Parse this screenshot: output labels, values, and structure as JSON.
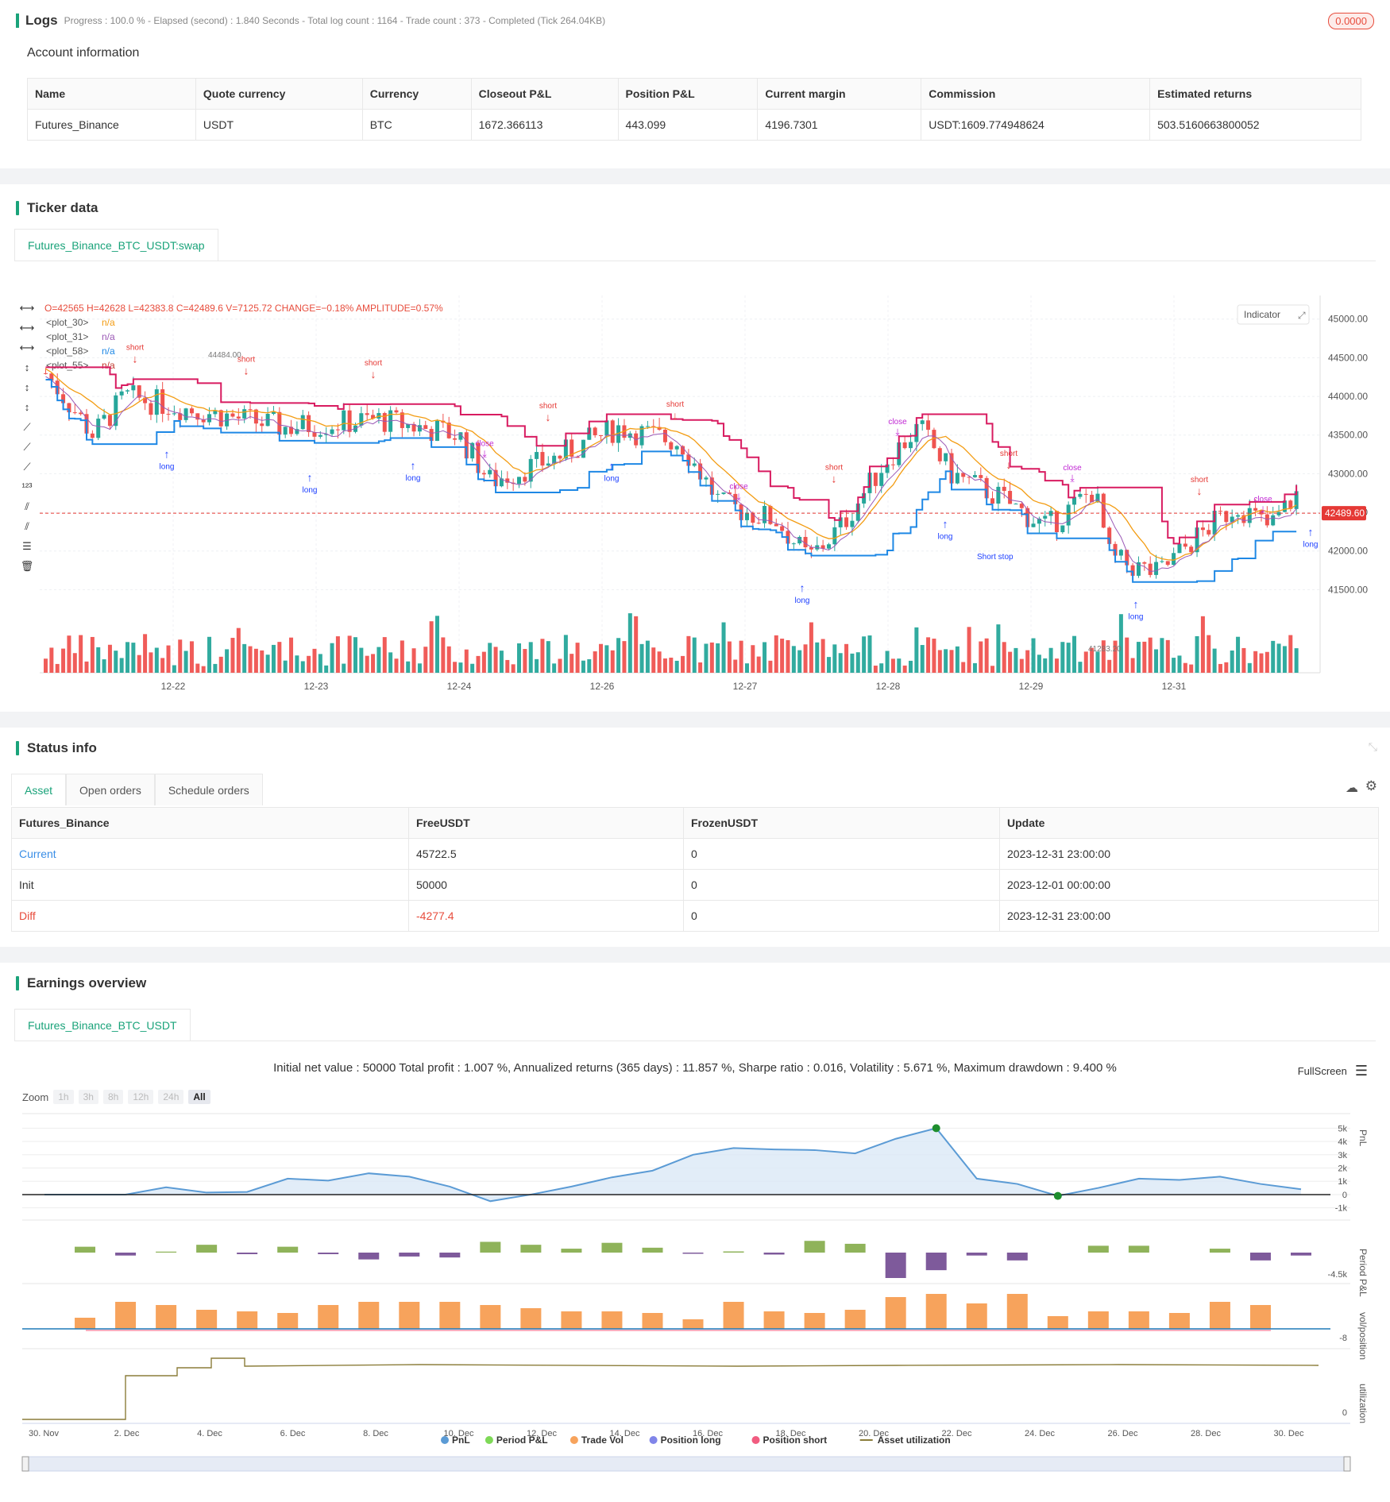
{
  "logs": {
    "title": "Logs",
    "meta": "Progress : 100.0 % - Elapsed (second) : 1.840  Seconds - Total log count : 1164 - Trade count : 373 - Completed (Tick 264.04KB)",
    "badge": "0.0000"
  },
  "account": {
    "title": "Account information",
    "headers": [
      "Name",
      "Quote currency",
      "Currency",
      "Closeout P&L",
      "Position P&L",
      "Current margin",
      "Commission",
      "Estimated returns"
    ],
    "row": [
      "Futures_Binance",
      "USDT",
      "BTC",
      "1672.366113",
      "443.099",
      "4196.7301",
      "USDT:1609.774948624",
      "503.5160663800052"
    ]
  },
  "ticker": {
    "title": "Ticker data",
    "tab": "Futures_Binance_BTC_USDT:swap",
    "ohlc": "O=42565  H=42628  L=42383.8  C=42489.6  V=7125.72  CHANGE=−0.18%  AMPLITUDE=0.57%",
    "plots": [
      {
        "name": "<plot_30>",
        "value": "n/a",
        "color": "#f39c12"
      },
      {
        "name": "<plot_31>",
        "value": "n/a",
        "color": "#9b59b6"
      },
      {
        "name": "<plot_58>",
        "value": "n/a",
        "color": "#1e88e5"
      },
      {
        "name": "<plot_55>",
        "value": "n/a",
        "color": "#c0392b"
      }
    ],
    "indicator_btn": "Indicator",
    "price_axis": [
      "45000.00",
      "44500.00",
      "44000.00",
      "43500.00",
      "43000.00",
      "42500.00",
      "42000.00",
      "41500.00"
    ],
    "current_price": "42489.60",
    "high_label": "44484.00",
    "low_label": "41283.20",
    "date_axis": [
      "12-22",
      "12-23",
      "12-24",
      "12-26",
      "12-27",
      "12-28",
      "12-29",
      "12-31"
    ],
    "labels": {
      "short": "short",
      "long": "long",
      "close": "close",
      "short_stop": "Short stop"
    }
  },
  "status": {
    "title": "Status info",
    "tabs": [
      "Asset",
      "Open orders",
      "Schedule orders"
    ],
    "headers": [
      "Futures_Binance",
      "FreeUSDT",
      "FrozenUSDT",
      "Update"
    ],
    "rows": [
      {
        "name": "Current",
        "free": "45722.5",
        "frozen": "0",
        "update": "2023-12-31 23:00:00"
      },
      {
        "name": "Init",
        "free": "50000",
        "frozen": "0",
        "update": "2023-12-01 00:00:00"
      },
      {
        "name": "Diff",
        "free": "-4277.4",
        "frozen": "0",
        "update": "2023-12-31 23:00:00"
      }
    ]
  },
  "earnings": {
    "title": "Earnings overview",
    "tab": "Futures_Binance_BTC_USDT",
    "summary": "Initial net value : 50000  Total profit : 1.007 %, Annualized returns (365 days) : 11.857 %, Sharpe ratio : 0.016, Volatility : 5.671 %, Maximum drawdown : 9.400 %",
    "fullscreen": "FullScreen",
    "zoom_label": "Zoom",
    "zoom_options": [
      "1h",
      "3h",
      "8h",
      "12h",
      "24h",
      "All"
    ],
    "pnl_axis": [
      "5k",
      "4k",
      "3k",
      "2k",
      "1k",
      "0",
      "-1k"
    ],
    "period_axis": "-4.5k",
    "vol_axis": "-8",
    "y_labels": [
      "PnL",
      "Period P&L",
      "vol/position",
      "utilization"
    ],
    "date_axis": [
      "30. Nov",
      "2. Dec",
      "4. Dec",
      "6. Dec",
      "8. Dec",
      "10. Dec",
      "12. Dec",
      "14. Dec",
      "16. Dec",
      "18. Dec",
      "20. Dec",
      "22. Dec",
      "24. Dec",
      "26. Dec",
      "28. Dec",
      "30. Dec"
    ],
    "legend": [
      {
        "name": "PnL",
        "color": "#5b9bd5"
      },
      {
        "name": "Period P&L",
        "color": "#7ed957"
      },
      {
        "name": "Trade Vol",
        "color": "#f7a35c"
      },
      {
        "name": "Position long",
        "color": "#8085e9"
      },
      {
        "name": "Position short",
        "color": "#f15c80"
      },
      {
        "name": "Asset utilization",
        "color": "#8b7d3a"
      }
    ]
  }
}
